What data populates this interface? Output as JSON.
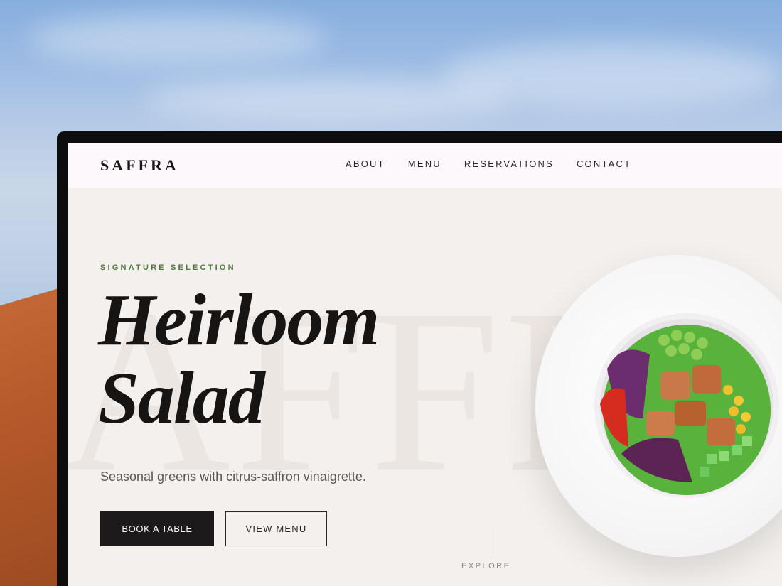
{
  "brand": "SAFFRA",
  "nav": {
    "items": [
      "ABOUT",
      "MENU",
      "RESERVATIONS",
      "CONTACT"
    ]
  },
  "hero": {
    "watermark": "AFFRA",
    "eyebrow": "SIGNATURE SELECTION",
    "title_line1": "Heirloom",
    "title_line2": "Salad",
    "subtitle": "Seasonal greens with citrus-saffron vinaigrette.",
    "primary_cta": "BOOK A TABLE",
    "secondary_cta": "VIEW MENU",
    "explore": "EXPLORE"
  },
  "colors": {
    "accent_green": "#4e7a3e",
    "ink": "#1c1a1a",
    "background": "#f3f0ed"
  }
}
